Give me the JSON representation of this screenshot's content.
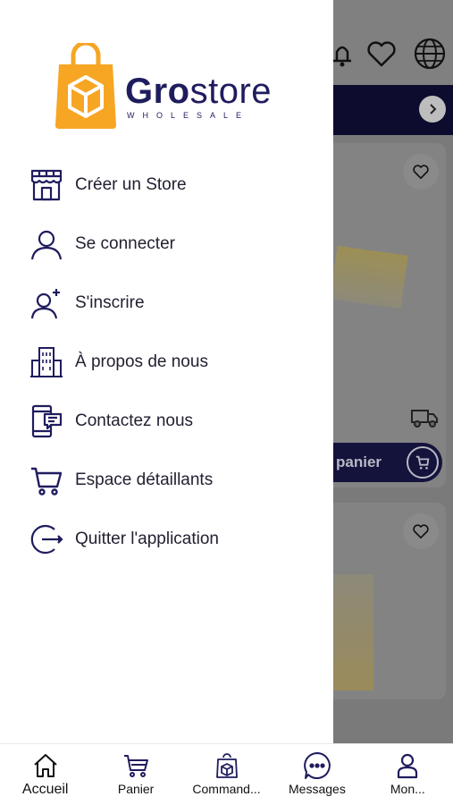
{
  "brand": {
    "name_bold": "Gro",
    "name_light": "store",
    "subtitle": "WHOLESALE",
    "primary_color": "#1f1c5e",
    "accent_color": "#f6a623"
  },
  "drawer": {
    "items": [
      {
        "label": "Créer un Store",
        "icon": "store-icon"
      },
      {
        "label": "Se connecter",
        "icon": "user-icon"
      },
      {
        "label": "S'inscrire",
        "icon": "user-add-icon"
      },
      {
        "label": "À propos de nous",
        "icon": "building-icon"
      },
      {
        "label": "Contactez nous",
        "icon": "phone-message-icon"
      },
      {
        "label": "Espace détaillants",
        "icon": "cart-icon"
      },
      {
        "label": "Quitter l'application",
        "icon": "logout-icon"
      }
    ]
  },
  "background": {
    "add_to_cart_label": "panier"
  },
  "bottom_nav": {
    "items": [
      {
        "label": "Accueil",
        "icon": "home-icon"
      },
      {
        "label": "Panier",
        "icon": "cart-icon"
      },
      {
        "label": "Command...",
        "icon": "package-icon"
      },
      {
        "label": "Messages",
        "icon": "chat-icon"
      },
      {
        "label": "Mon...",
        "icon": "profile-icon"
      }
    ]
  }
}
